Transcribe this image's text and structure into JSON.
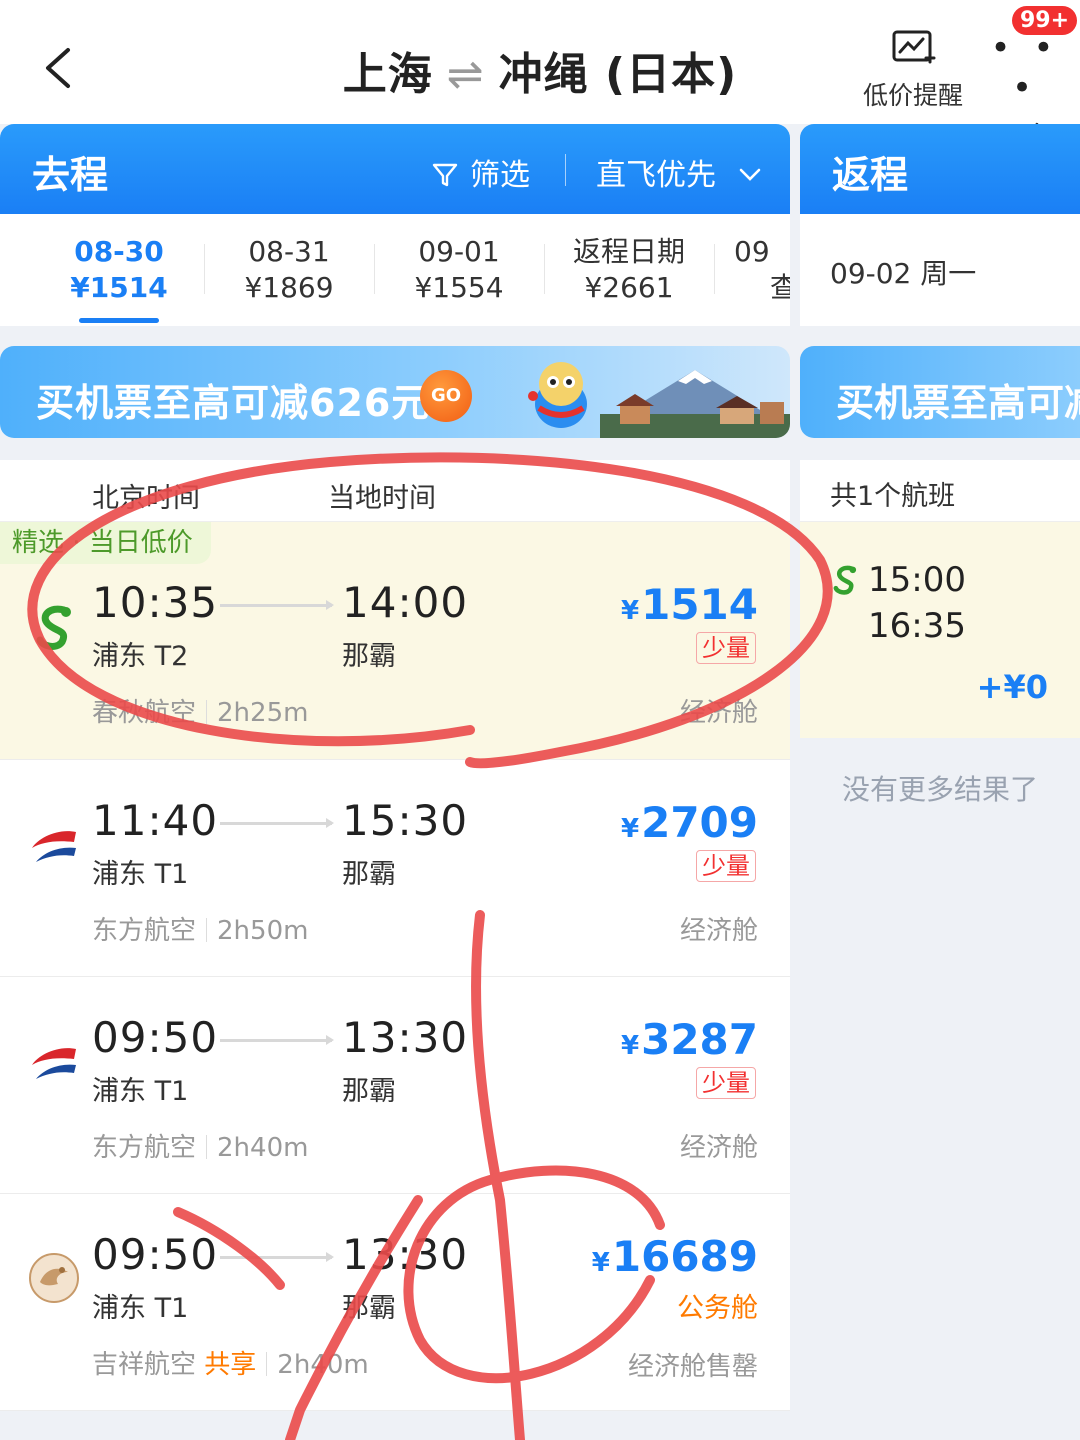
{
  "header": {
    "title_from": "上海",
    "title_arrow": "⇌",
    "title_to": "冲绳 (日本)",
    "price_alert_label": "低价提醒",
    "more_label": "更多",
    "more_dots": "• • •",
    "badge": "99+"
  },
  "outbound": {
    "tab_title": "去程",
    "filter_label": "筛选",
    "sort_label": "直飞优先",
    "dates": [
      {
        "date": "08-30",
        "price": "¥1514"
      },
      {
        "date": "08-31",
        "price": "¥1869"
      },
      {
        "date": "09-01",
        "price": "¥1554"
      },
      {
        "date": "返程日期",
        "price": "¥2661"
      },
      {
        "date": "09",
        "price": "查"
      }
    ],
    "banner_text": "买机票至高可减626元",
    "banner_go": "GO",
    "list_header": {
      "beijing_time": "北京时间",
      "local_time": "当地时间"
    },
    "featured_tag": "精选 · 当日低价",
    "flights": [
      {
        "dep_time": "10:35",
        "dep_airport": "浦东 T2",
        "arr_time": "14:00",
        "arr_airport": "那霸",
        "currency": "¥",
        "price": "1514",
        "stock": "少量",
        "airline": "春秋航空",
        "duration": "2h25m",
        "cabin": "经济舱",
        "logo": "spring-airlines-logo-icon"
      },
      {
        "dep_time": "11:40",
        "dep_airport": "浦东 T1",
        "arr_time": "15:30",
        "arr_airport": "那霸",
        "currency": "¥",
        "price": "2709",
        "stock": "少量",
        "airline": "东方航空",
        "duration": "2h50m",
        "cabin": "经济舱",
        "logo": "china-eastern-logo-icon"
      },
      {
        "dep_time": "09:50",
        "dep_airport": "浦东 T1",
        "arr_time": "13:30",
        "arr_airport": "那霸",
        "currency": "¥",
        "price": "3287",
        "stock": "少量",
        "airline": "东方航空",
        "duration": "2h40m",
        "cabin": "经济舱",
        "logo": "china-eastern-logo-icon"
      },
      {
        "dep_time": "09:50",
        "dep_airport": "浦东 T1",
        "arr_time": "13:30",
        "arr_airport": "那霸",
        "currency": "¥",
        "price": "16689",
        "cabin_tag": "公务舱",
        "airline": "吉祥航空",
        "share_tag": "共享",
        "duration": "2h40m",
        "cabin": "经济舱售罄",
        "logo": "juneyao-logo-icon"
      }
    ]
  },
  "return": {
    "tab_title": "返程",
    "date": "09-02 周一",
    "banner_text": "买机票至高可减",
    "count_text": "共1个航班",
    "flight": {
      "dep_time": "15:00",
      "arr_time": "16:35",
      "diff": "+¥0"
    },
    "no_more": "没有更多结果了"
  },
  "colors": {
    "accent": "#1a7ff5",
    "featured_bg": "#fbf8e4",
    "stock_red": "#f23030",
    "annotation": "#ea4a4a"
  }
}
